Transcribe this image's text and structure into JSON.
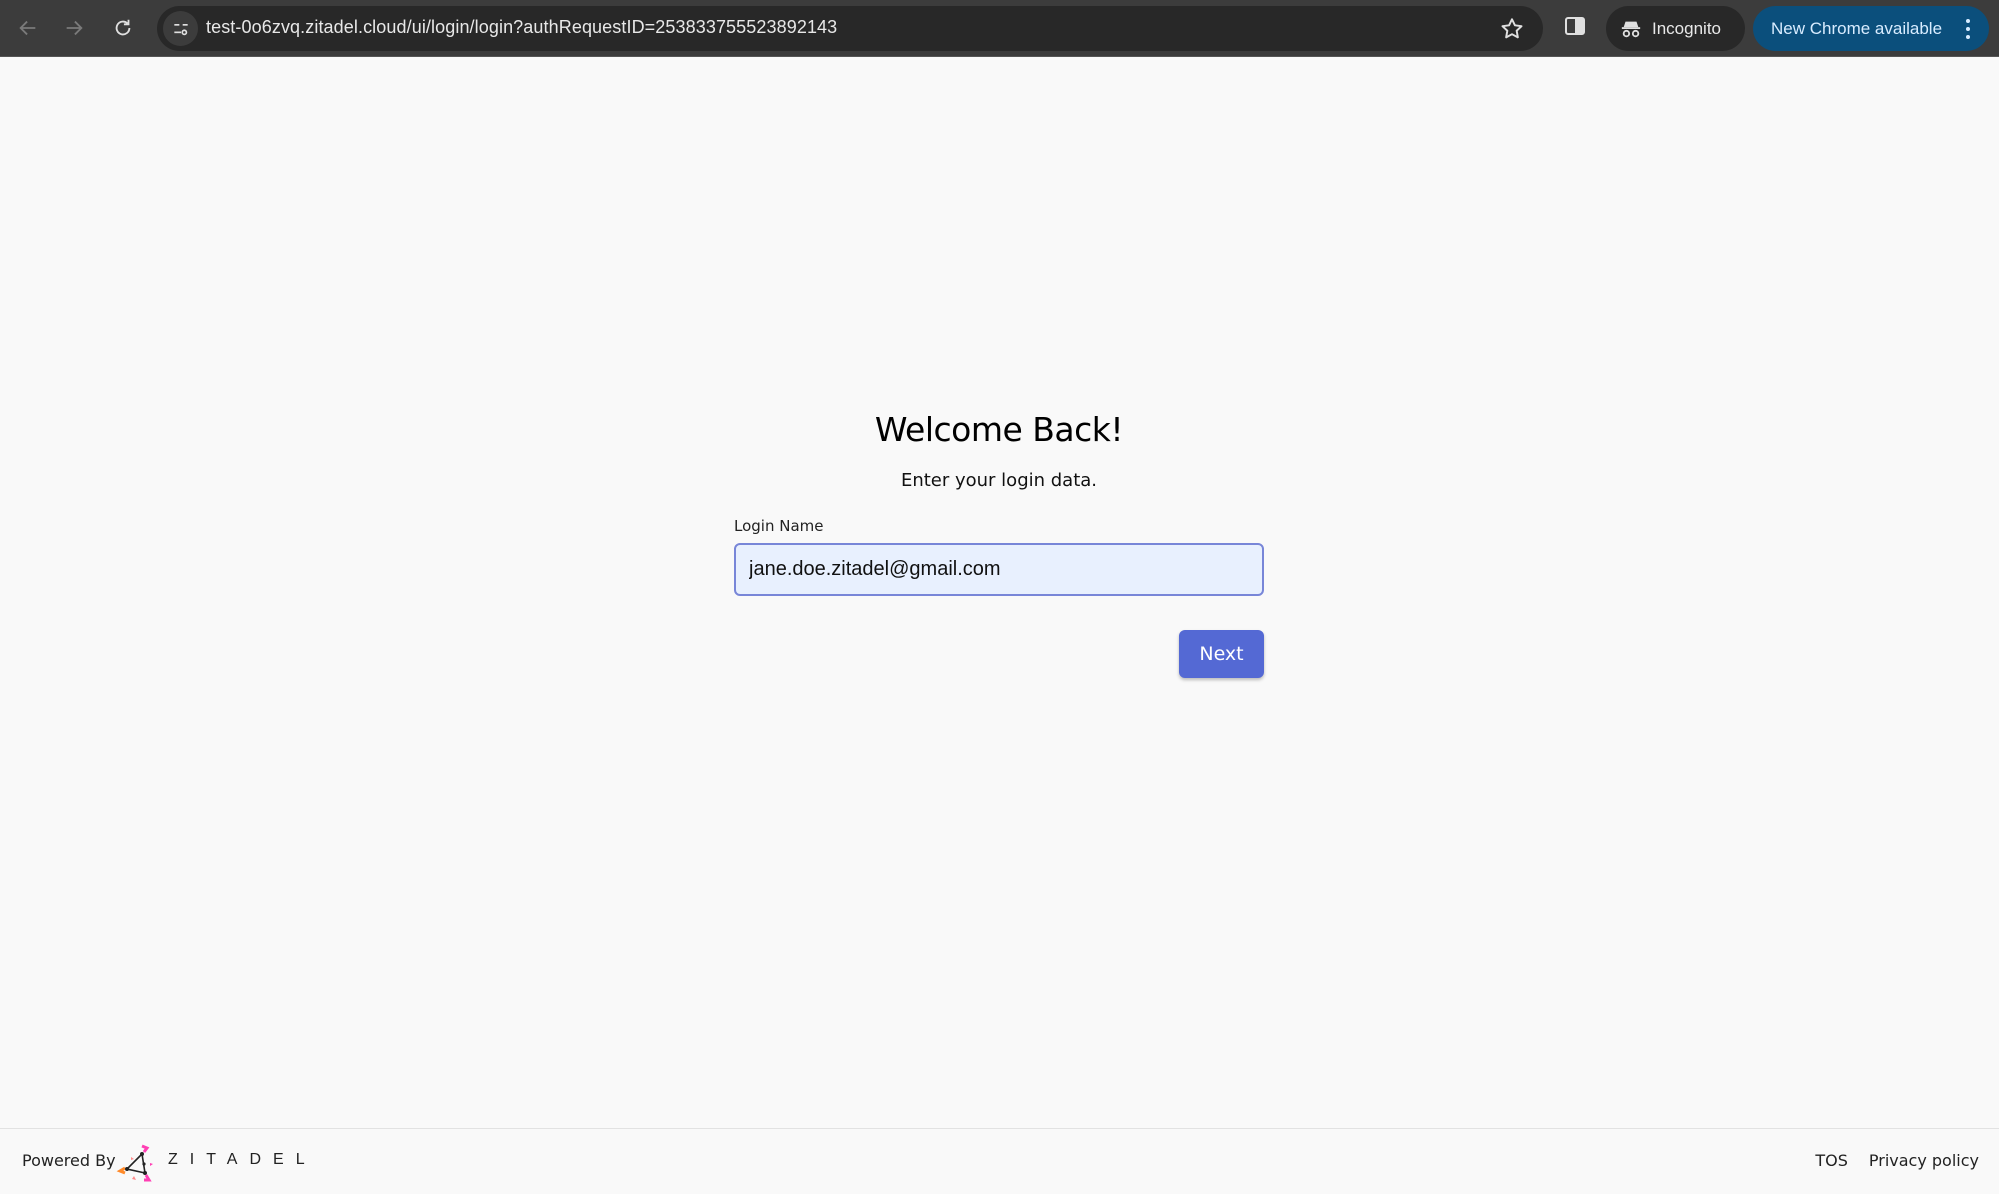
{
  "browser": {
    "url": "test-0o6zvq.zitadel.cloud/ui/login/login?authRequestID=253833755523892143",
    "incognito_label": "Incognito",
    "update_label": "New Chrome available",
    "icons": {
      "back": "arrow-left",
      "forward": "arrow-right",
      "reload": "reload",
      "site_info": "tune",
      "bookmark": "star",
      "side_panel": "side-panel",
      "incognito": "incognito",
      "menu": "kebab"
    },
    "colors": {
      "toolbar": "#3c3c3c",
      "omnibox": "#282828",
      "update_button": "#0b4f7c"
    }
  },
  "login": {
    "title": "Welcome Back!",
    "subtitle": "Enter your login data.",
    "login_name_label": "Login Name",
    "login_name_value": "jane.doe.zitadel@gmail.com",
    "next_label": "Next",
    "colors": {
      "primary": "#5469d4",
      "input_bg": "#e8f0fe",
      "input_border": "#7886d8"
    }
  },
  "footer": {
    "powered_by": "Powered By",
    "brand": "ZITADEL",
    "links": [
      "TOS",
      "Privacy policy"
    ]
  }
}
